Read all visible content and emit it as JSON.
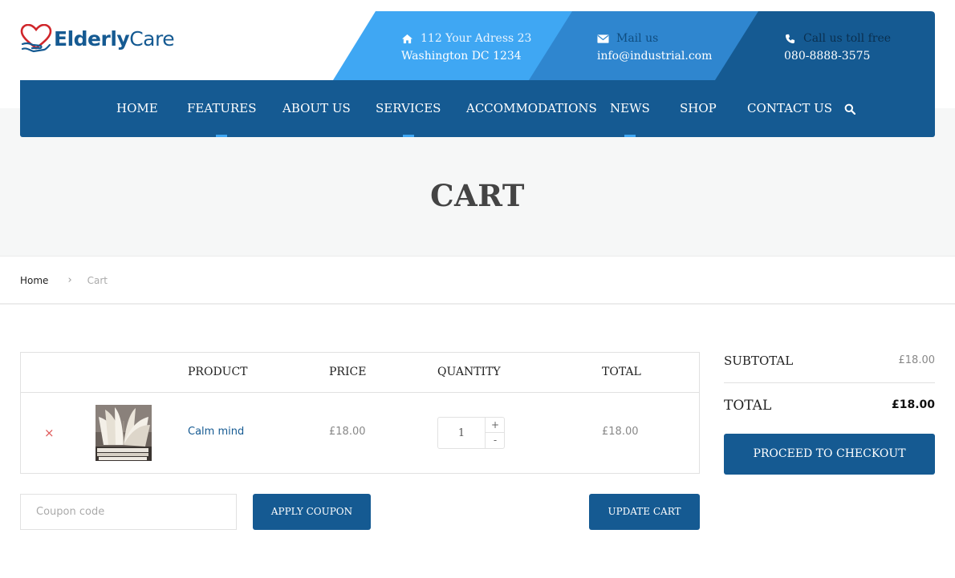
{
  "logo": {
    "part1": "Elderly",
    "part2": "Care"
  },
  "contacts": [
    {
      "icon": "home-icon",
      "line1": "112 Your Adress 23",
      "line2": "Washington DC 1234"
    },
    {
      "icon": "envelope-icon",
      "line1": "Mail us",
      "line2": "info@industrial.com"
    },
    {
      "icon": "phone-icon",
      "line1": "Call us toll free",
      "line2": "080-8888-3575"
    }
  ],
  "nav": {
    "items": [
      {
        "label": "HOME",
        "marked": false
      },
      {
        "label": "FEATURES",
        "marked": true
      },
      {
        "label": "ABOUT US",
        "marked": false
      },
      {
        "label": "SERVICES",
        "marked": true
      },
      {
        "label": "ACCOMMODATIONS",
        "marked": false
      },
      {
        "label": "NEWS",
        "marked": true
      },
      {
        "label": "SHOP",
        "marked": false
      },
      {
        "label": "CONTACT US",
        "marked": false
      }
    ],
    "search_icon": "search-icon"
  },
  "page": {
    "title": "CART"
  },
  "breadcrumb": {
    "home": "Home",
    "separator": ">",
    "current": "Cart"
  },
  "cart": {
    "headers": {
      "product": "PRODUCT",
      "price": "PRICE",
      "quantity": "QUANTITY",
      "total": "TOTAL"
    },
    "items": [
      {
        "remove": "×",
        "name": "Calm mind",
        "price": "£18.00",
        "quantity": "1",
        "total": "£18.00"
      }
    ],
    "qty_plus": "+",
    "qty_minus": "-"
  },
  "coupon": {
    "placeholder": "Coupon code",
    "apply_label": "APPLY COUPON"
  },
  "update_label": "UPDATE CART",
  "totals": {
    "subtotal_label": "SUBTOTAL",
    "subtotal_value": "£18.00",
    "total_label": "TOTAL",
    "total_value": "£18.00",
    "checkout_label": "PROCEED TO CHECKOUT"
  },
  "colors": {
    "primary": "#155a92",
    "accent_light": "#3fa7f3",
    "band_mid": "#2f86cf",
    "remove": "#e05a5a",
    "hero_bg": "#f6f7f7"
  }
}
